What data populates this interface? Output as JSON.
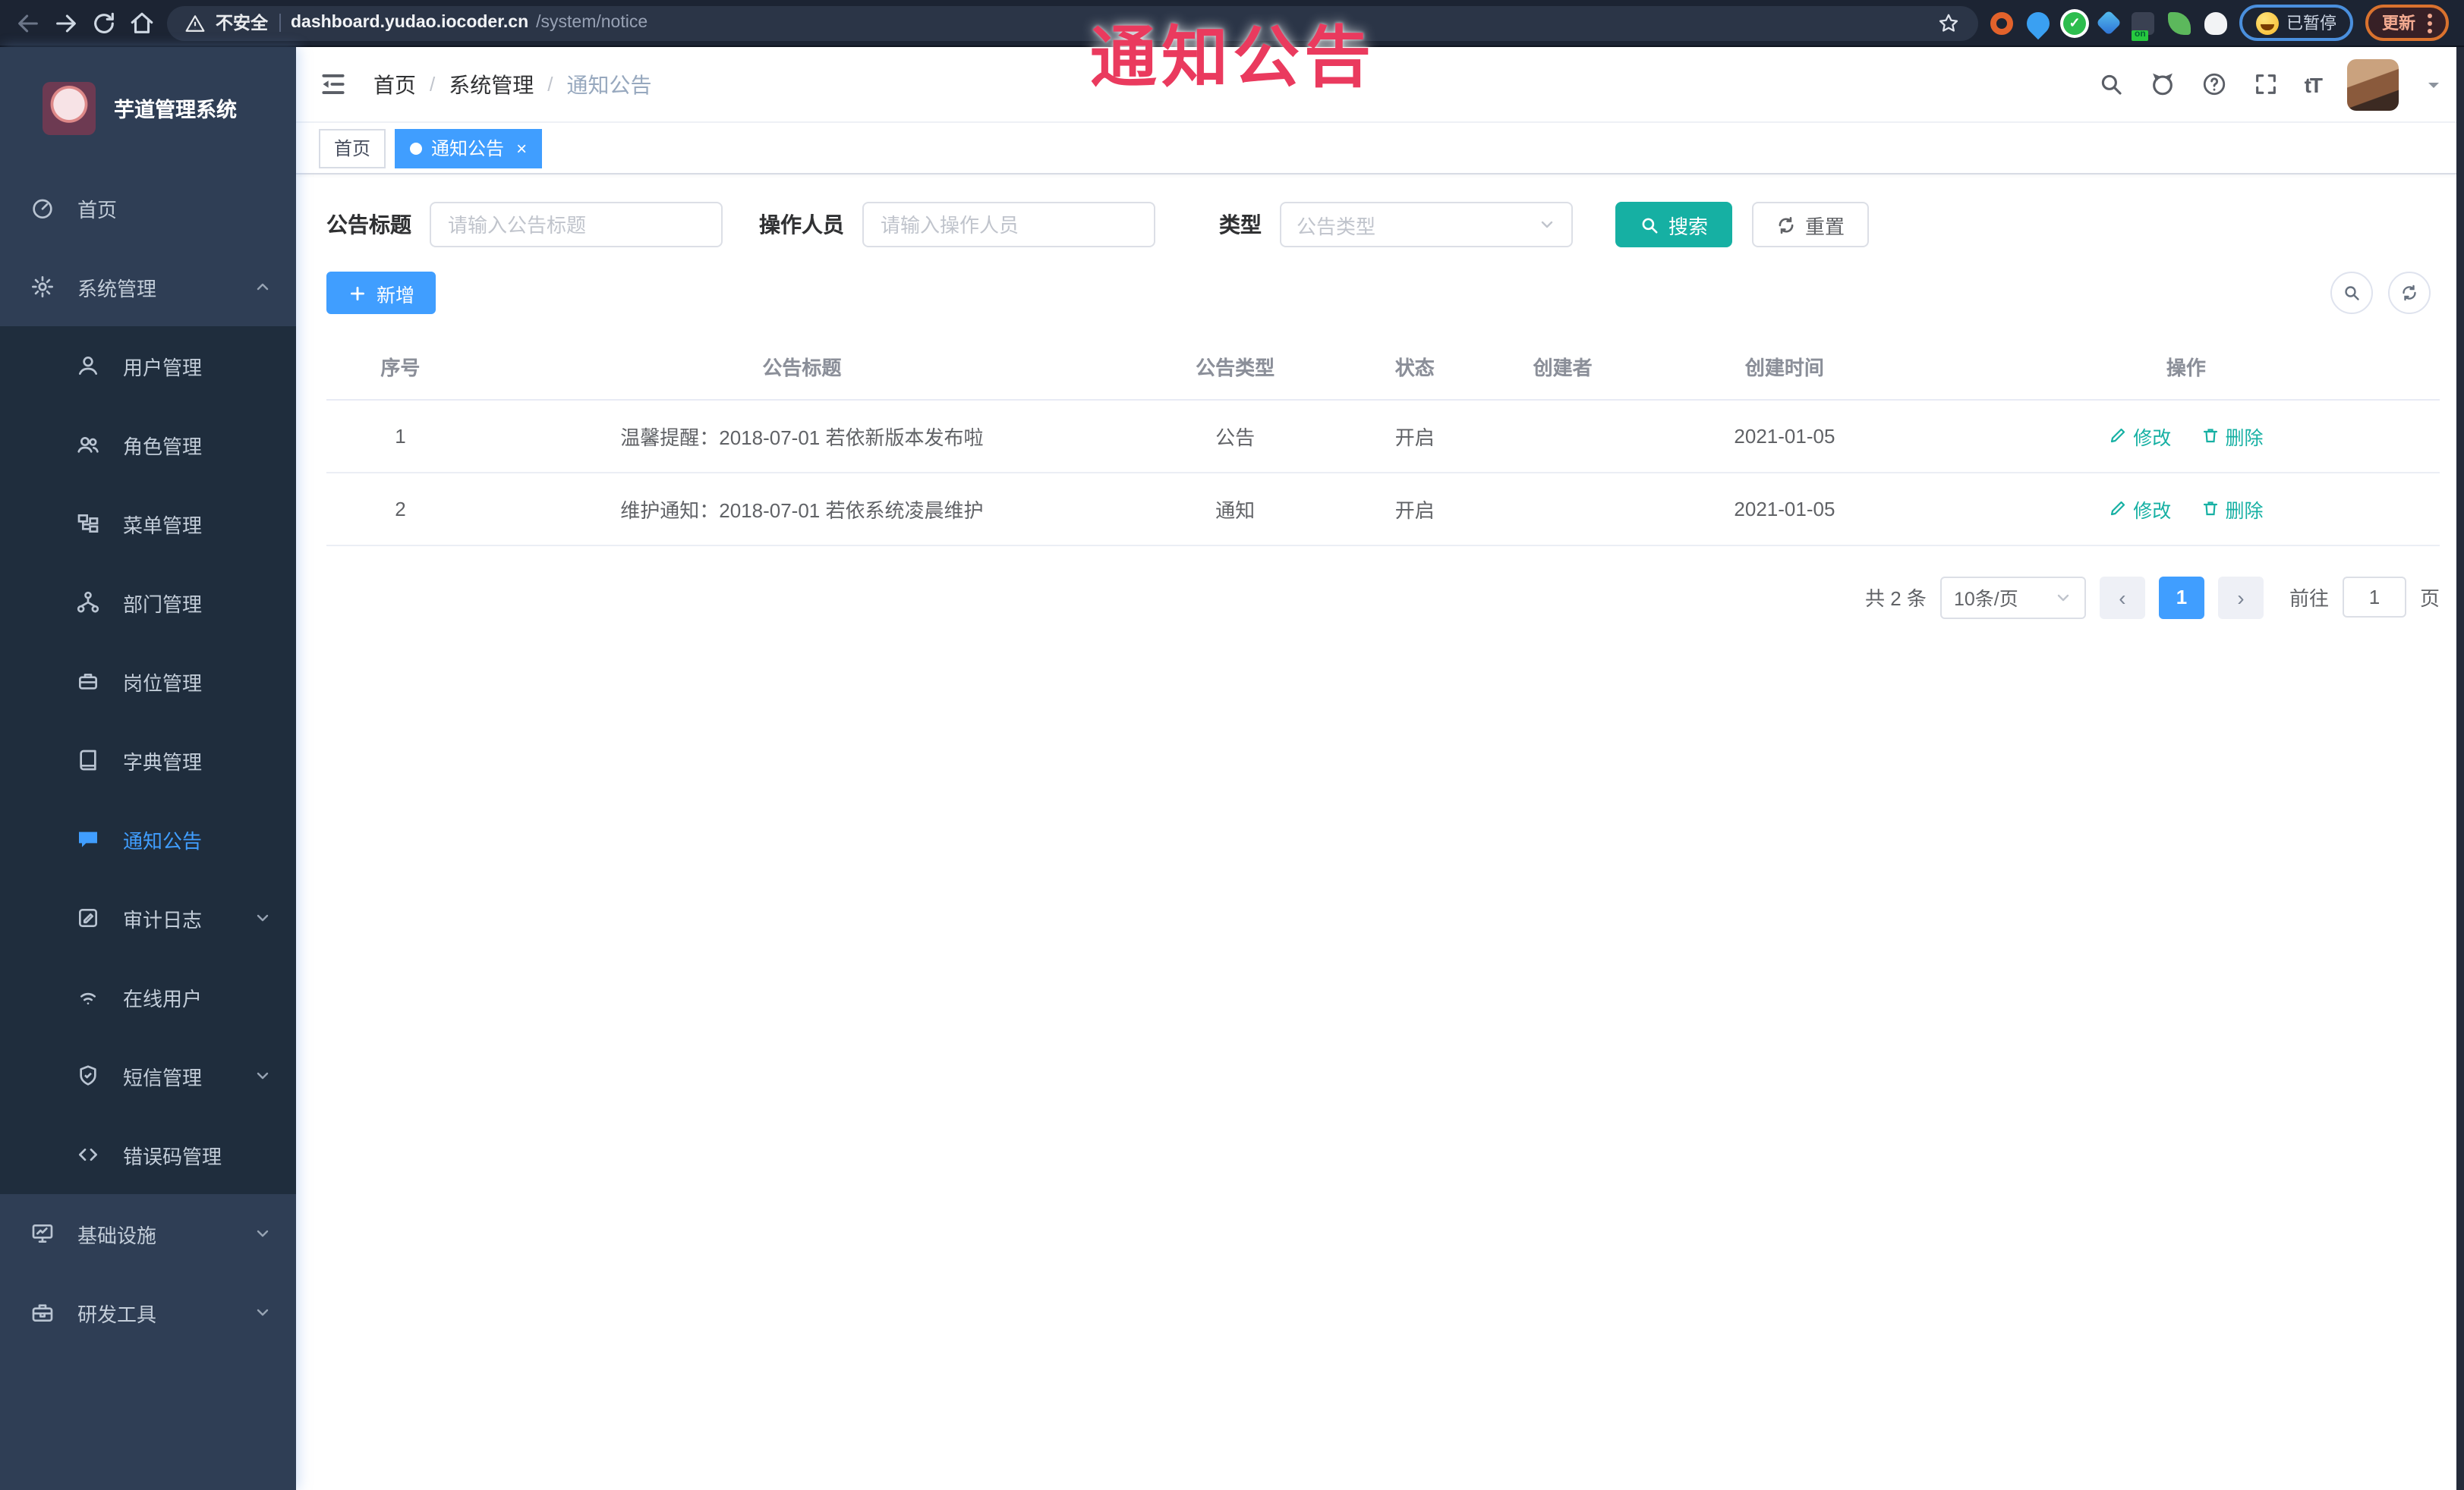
{
  "annotation": {
    "text": "通知公告"
  },
  "browser": {
    "security_label": "不安全",
    "url_host": "dashboard.yudao.iocoder.cn",
    "url_path": "/system/notice",
    "ext_on_badge": "on",
    "paused_label": "已暂停",
    "update_label": "更新"
  },
  "sidebar": {
    "title": "芋道管理系统",
    "items": [
      {
        "label": "首页",
        "icon": "dashboard-icon"
      },
      {
        "label": "系统管理",
        "icon": "gear-icon",
        "expanded": true
      },
      {
        "label": "用户管理",
        "icon": "user-icon"
      },
      {
        "label": "角色管理",
        "icon": "peoples-icon"
      },
      {
        "label": "菜单管理",
        "icon": "tree-table-icon"
      },
      {
        "label": "部门管理",
        "icon": "tree-icon"
      },
      {
        "label": "岗位管理",
        "icon": "post-icon"
      },
      {
        "label": "字典管理",
        "icon": "dict-icon"
      },
      {
        "label": "通知公告",
        "icon": "message-icon",
        "active": true
      },
      {
        "label": "审计日志",
        "icon": "log-icon",
        "collapsed": true
      },
      {
        "label": "在线用户",
        "icon": "online-icon"
      },
      {
        "label": "短信管理",
        "icon": "sms-icon",
        "collapsed": true
      },
      {
        "label": "错误码管理",
        "icon": "code-icon"
      },
      {
        "label": "基础设施",
        "icon": "monitor-icon",
        "collapsed": true
      },
      {
        "label": "研发工具",
        "icon": "tool-icon",
        "collapsed": true
      }
    ]
  },
  "header": {
    "breadcrumb": [
      "首页",
      "系统管理",
      "通知公告"
    ],
    "breadcrumb_separator": "/",
    "font_icon_label": "tT"
  },
  "tabs": [
    {
      "label": "首页",
      "active": false
    },
    {
      "label": "通知公告",
      "active": true,
      "close": "×"
    }
  ],
  "filters": {
    "title_label": "公告标题",
    "title_placeholder": "请输入公告标题",
    "operator_label": "操作人员",
    "operator_placeholder": "请输入操作人员",
    "type_label": "类型",
    "type_placeholder": "公告类型",
    "search_label": "搜索",
    "reset_label": "重置"
  },
  "toolbar": {
    "add_label": "新增"
  },
  "table": {
    "columns": [
      "序号",
      "公告标题",
      "公告类型",
      "状态",
      "创建者",
      "创建时间",
      "操作"
    ],
    "rows": [
      {
        "no": "1",
        "title": "温馨提醒：2018-07-01 若依新版本发布啦",
        "type": "公告",
        "status": "开启",
        "creator": "",
        "created": "2021-01-05",
        "edit": "修改",
        "delete": "删除"
      },
      {
        "no": "2",
        "title": "维护通知：2018-07-01 若依系统凌晨维护",
        "type": "通知",
        "status": "开启",
        "creator": "",
        "created": "2021-01-05",
        "edit": "修改",
        "delete": "删除"
      }
    ]
  },
  "pagination": {
    "total_label": "共 2 条",
    "page_size_label": "10条/页",
    "prev_label": "‹",
    "page": "1",
    "next_label": "›",
    "goto_label": "前往",
    "goto_value": "1",
    "unit_label": "页"
  },
  "colors": {
    "primary": "#409eff",
    "teal": "#16b0a3",
    "sidebar": "#2f3e55",
    "submenu": "#1f2d3d",
    "annotation": "#ea3a5e"
  }
}
